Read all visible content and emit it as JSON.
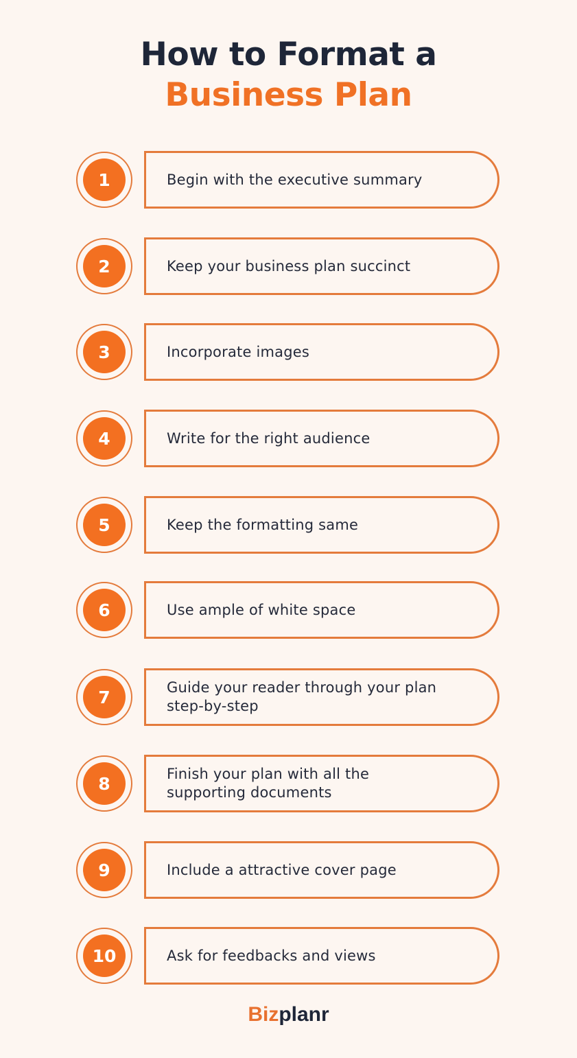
{
  "title": {
    "line1": "How to Format a",
    "line2": "Business Plan"
  },
  "colors": {
    "background": "#fdf6f1",
    "accent": "#f37021",
    "border": "#e47b3c",
    "dark": "#1e2638"
  },
  "steps": [
    {
      "number": "1",
      "text": "Begin with the executive summary"
    },
    {
      "number": "2",
      "text": "Keep your business plan succinct"
    },
    {
      "number": "3",
      "text": "Incorporate images"
    },
    {
      "number": "4",
      "text": "Write for the right audience"
    },
    {
      "number": "5",
      "text": "Keep the formatting same"
    },
    {
      "number": "6",
      "text": "Use ample of white space"
    },
    {
      "number": "7",
      "text": "Guide your reader through your plan step-by-step"
    },
    {
      "number": "8",
      "text": "Finish your plan with all the supporting documents"
    },
    {
      "number": "9",
      "text": "Include a attractive cover page"
    },
    {
      "number": "10",
      "text": "Ask for feedbacks and views"
    }
  ],
  "logo": {
    "part1": "Biz",
    "part2": "planr"
  }
}
